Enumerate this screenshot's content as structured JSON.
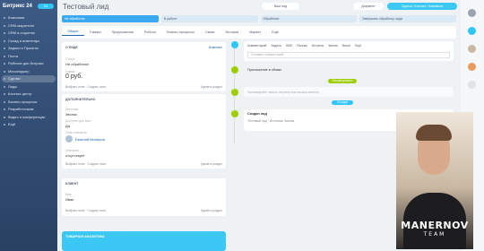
{
  "sidebar": {
    "brand": "Битрикс 24",
    "badge": "24",
    "items": [
      "Компании",
      "CRM-маркетинг",
      "CRM в соцсетях",
      "Склад и инвентарь",
      "Задачи и Проекты",
      "Почта",
      "Рабочие дни Битрикс",
      "Мессенджер",
      "Сделки",
      "Лиды",
      "Контакт-центр",
      "Бизнес-процессы",
      "Разработчикам",
      "Видео и конференции",
      "Ещё"
    ],
    "active_index": 8
  },
  "header": {
    "title": "Тестовый лид",
    "btn1": "Ваш лид",
    "btn2": "Документ",
    "btn3": "Сделка / Контакт / Компания"
  },
  "stages": [
    "Не обработан",
    "В работе",
    "Обработан",
    "Завершить обработку лида"
  ],
  "tabs": [
    "Общие",
    "Товары",
    "Предложения",
    "Роботы",
    "Бизнес-процессы",
    "Связи",
    "История",
    "Маркет",
    "Ещё"
  ],
  "about": {
    "title": "О ЛИДЕ",
    "edit": "Изменить",
    "lbl_status": "Статус",
    "status": "Не обработан",
    "lbl_sum": "Сумма",
    "sum": "0 руб.",
    "foot_l": "Выбрать поле · Создать поле",
    "foot_r": "Удалить раздел"
  },
  "more": {
    "title": "ДОПОЛНИТЕЛЬНО",
    "lbl_source": "Источник",
    "source": "Звонок",
    "lbl_avail": "Доступен для всех",
    "avail": "Да",
    "lbl_resp": "Ответственный",
    "resp": "Евгений Минеров",
    "lbl_comment": "Описание",
    "comment": "отсутствует",
    "foot_l": "Выбрать поле · Создать поле",
    "foot_r": "Удалить раздел"
  },
  "client": {
    "title": "КЛИЕНТ",
    "lbl_name": "Имя",
    "name": "Иван",
    "foot_l": "Выбрать поле · Создать поле",
    "foot_r": "Удалить раздел"
  },
  "products": {
    "label": "ТОВАРНАЯ АНАЛИТИКА"
  },
  "timeline": {
    "tabs": [
      "Комментарий",
      "Задача",
      "SMS",
      "Письмо",
      "Встреча",
      "Звонок",
      "Визит",
      "Ещё"
    ],
    "placeholder": "Оставьте комментарий",
    "assistant": "Приглашение в облако",
    "planned": "Запланировано",
    "hint": "Запланируйте звонок, встречу или письмо клиенту",
    "today": "Сегодня",
    "entry_title": "Создан лид",
    "entry_text": "Тестовый лид · Источник: Звонок",
    "entry_action": "Изменить"
  },
  "video_logo": {
    "name": "MANERNOV",
    "sub": "TEAM"
  }
}
